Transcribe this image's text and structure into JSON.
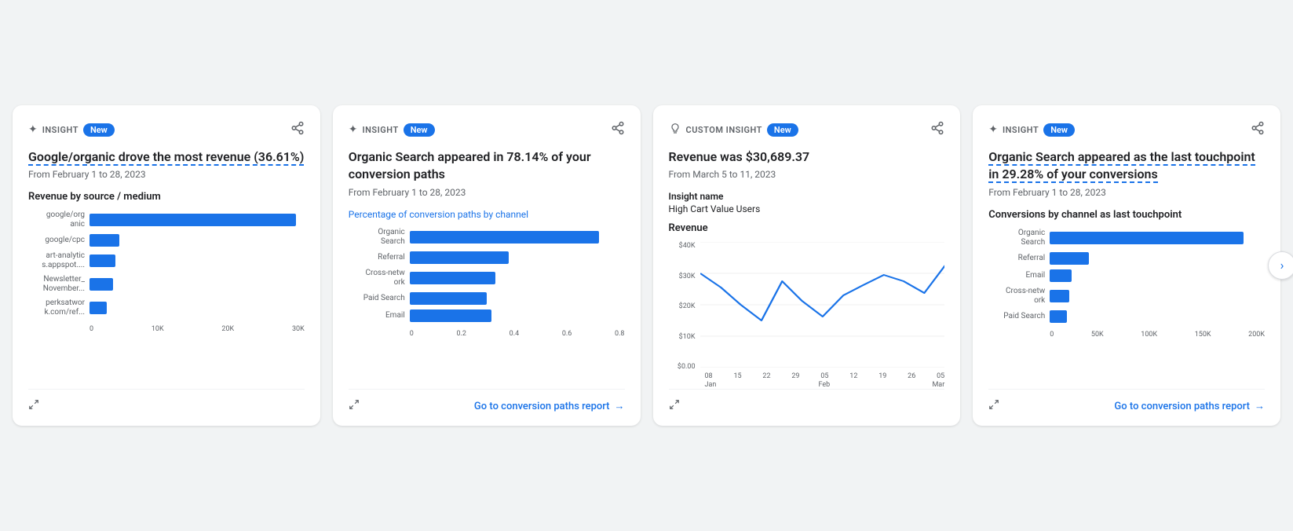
{
  "cards": [
    {
      "id": "card1",
      "type": "INSIGHT",
      "type_icon": "sparkle",
      "new_badge": "New",
      "title_parts": [
        "Google/organic drove the most revenue (36.61%)"
      ],
      "subtitle": "From February 1 to 28, 2023",
      "chart_title": "Revenue by source / medium",
      "chart_type": "bar_horizontal",
      "bars": [
        {
          "label": "google/org anic",
          "value": 96,
          "display": ""
        },
        {
          "label": "google/cpc",
          "value": 14,
          "display": ""
        },
        {
          "label": "art-analytic s.appspot....",
          "value": 12,
          "display": ""
        },
        {
          "label": "Newsletter_ November...",
          "value": 11,
          "display": ""
        },
        {
          "label": "perksatwor k.com/ref...",
          "value": 8,
          "display": ""
        }
      ],
      "x_ticks": [
        "0",
        "10K",
        "20K",
        "30K"
      ],
      "footer_link": null,
      "footer_link_text": null
    },
    {
      "id": "card2",
      "type": "INSIGHT",
      "type_icon": "sparkle",
      "new_badge": "New",
      "title_parts": [
        "Organic Search appeared in 78.14% of your conversion paths"
      ],
      "subtitle": "From February 1 to 28, 2023",
      "chart_subtitle": "Percentage of conversion paths by channel",
      "chart_type": "bar_horizontal",
      "bars": [
        {
          "label": "Organic Search",
          "value": 88,
          "display": ""
        },
        {
          "label": "Referral",
          "value": 46,
          "display": ""
        },
        {
          "label": "Cross-netw ork",
          "value": 40,
          "display": ""
        },
        {
          "label": "Paid Search",
          "value": 36,
          "display": ""
        },
        {
          "label": "Email",
          "value": 38,
          "display": ""
        }
      ],
      "x_ticks": [
        "0",
        "0.2",
        "0.4",
        "0.6",
        "0.8"
      ],
      "footer_link": true,
      "footer_link_text": "Go to conversion paths report"
    },
    {
      "id": "card3",
      "type": "CUSTOM INSIGHT",
      "type_icon": "bulb",
      "new_badge": "New",
      "title_parts": [
        "Revenue was $30,689.37"
      ],
      "subtitle": "From March 5 to 11, 2023",
      "insight_name_label": "Insight name",
      "insight_name_value": "High Cart Value Users",
      "chart_title": "Revenue",
      "chart_type": "line",
      "line_data": [
        {
          "x": 0,
          "y": 75
        },
        {
          "x": 10,
          "y": 62
        },
        {
          "x": 20,
          "y": 50
        },
        {
          "x": 30,
          "y": 35
        },
        {
          "x": 40,
          "y": 68
        },
        {
          "x": 50,
          "y": 48
        },
        {
          "x": 60,
          "y": 38
        },
        {
          "x": 70,
          "y": 55
        },
        {
          "x": 80,
          "y": 62
        },
        {
          "x": 90,
          "y": 70
        },
        {
          "x": 100,
          "y": 65
        },
        {
          "x": 110,
          "y": 55
        },
        {
          "x": 120,
          "y": 78
        }
      ],
      "y_ticks": [
        "$40K",
        "$30K",
        "$20K",
        "$10K",
        "$0.00"
      ],
      "x_labels_row1": [
        "08",
        "15",
        "22",
        "29",
        "05",
        "12",
        "19",
        "26",
        "05"
      ],
      "x_labels_row2": [
        "Jan",
        "",
        "",
        "",
        "Feb",
        "",
        "",
        "",
        "Mar"
      ],
      "footer_link": null,
      "footer_link_text": null
    },
    {
      "id": "card4",
      "type": "INSIGHT",
      "type_icon": "sparkle",
      "new_badge": "New",
      "title_parts": [
        "Organic Search appeared as the last touchpoint in 29.28% of your conversions"
      ],
      "subtitle": "From February 1 to 28, 2023",
      "chart_title": "Conversions by channel as last touchpoint",
      "chart_type": "bar_horizontal",
      "bars": [
        {
          "label": "Organic Search",
          "value": 90,
          "display": ""
        },
        {
          "label": "Referral",
          "value": 18,
          "display": ""
        },
        {
          "label": "Email",
          "value": 10,
          "display": ""
        },
        {
          "label": "Cross-netw ork",
          "value": 9,
          "display": ""
        },
        {
          "label": "Paid Search",
          "value": 8,
          "display": ""
        }
      ],
      "x_ticks": [
        "0",
        "50K",
        "100K",
        "150K",
        "200K"
      ],
      "footer_link": true,
      "footer_link_text": "Go to conversion paths report"
    }
  ],
  "icons": {
    "sparkle": "✦",
    "bulb": "💡",
    "share": "⬆",
    "expand": "⛶",
    "arrow_right": "→",
    "chevron_right": "›"
  }
}
